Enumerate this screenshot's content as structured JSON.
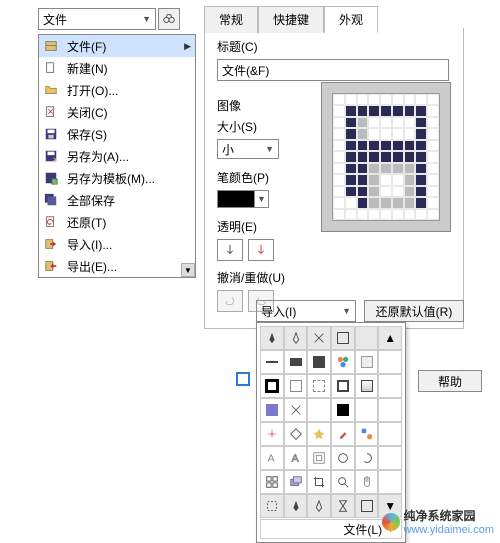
{
  "topDropdown": "文件",
  "tabs": {
    "general": "常规",
    "shortcut": "快捷键",
    "appearance": "外观"
  },
  "menu": {
    "items": [
      {
        "label": "文件(F)",
        "icon": "file-cabinet",
        "arrow": true,
        "selected": true
      },
      {
        "label": "新建(N)",
        "icon": "new-doc"
      },
      {
        "label": "打开(O)...",
        "icon": "folder-open"
      },
      {
        "label": "关闭(C)",
        "icon": "close-doc"
      },
      {
        "label": "保存(S)",
        "icon": "save-disk"
      },
      {
        "label": "另存为(A)...",
        "icon": "save-as-disk"
      },
      {
        "label": "另存为模板(M)...",
        "icon": "save-template"
      },
      {
        "label": "全部保存",
        "icon": "save-all"
      },
      {
        "label": "还原(T)",
        "icon": "revert"
      },
      {
        "label": "导入(I)...",
        "icon": "import"
      },
      {
        "label": "导出(E)...",
        "icon": "export"
      }
    ]
  },
  "config": {
    "titleLabel": "标题(C)",
    "titleValue": "文件(&F)",
    "imageSection": "图像",
    "sizeLabel": "大小(S)",
    "sizeValue": "小",
    "penColorLabel": "笔颜色(P)",
    "transparentLabel": "透明(E)",
    "undoRedoLabel": "撤消/重做(U)"
  },
  "importDropdown": "导入(I)",
  "restoreDefault": "还原默认值(R)",
  "help": "帮助",
  "paletteFooter": "文件(L)",
  "watermark": {
    "brand": "纯净系统家园",
    "url": "www.yidaimei.com"
  },
  "colors": {
    "accent": "#2a7ad6",
    "panel": "#bbb"
  }
}
